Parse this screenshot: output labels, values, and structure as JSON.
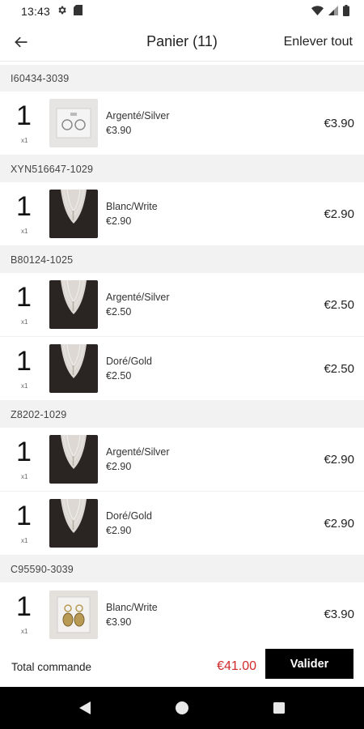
{
  "status_bar": {
    "time": "13:43",
    "icons": [
      "gear-icon",
      "sim-card-icon",
      "wifi-icon",
      "signal-icon",
      "battery-icon"
    ]
  },
  "header": {
    "title": "Panier (11)",
    "clear_all_label": "Enlever tout"
  },
  "groups": [
    {
      "code": "I60434-3039",
      "items": [
        {
          "qty": "1",
          "unit": "x1",
          "variant": "Argenté/Silver",
          "unit_price": "€3.90",
          "price": "€3.90",
          "thumb": "earrings"
        }
      ]
    },
    {
      "code": "XYN516647-1029",
      "items": [
        {
          "qty": "1",
          "unit": "x1",
          "variant": "Blanc/Write",
          "unit_price": "€2.90",
          "price": "€2.90",
          "thumb": "necklace"
        }
      ]
    },
    {
      "code": "B80124-1025",
      "items": [
        {
          "qty": "1",
          "unit": "x1",
          "variant": "Argenté/Silver",
          "unit_price": "€2.50",
          "price": "€2.50",
          "thumb": "necklace"
        },
        {
          "qty": "1",
          "unit": "x1",
          "variant": "Doré/Gold",
          "unit_price": "€2.50",
          "price": "€2.50",
          "thumb": "necklace"
        }
      ]
    },
    {
      "code": "Z8202-1029",
      "items": [
        {
          "qty": "1",
          "unit": "x1",
          "variant": "Argenté/Silver",
          "unit_price": "€2.90",
          "price": "€2.90",
          "thumb": "necklace"
        },
        {
          "qty": "1",
          "unit": "x1",
          "variant": "Doré/Gold",
          "unit_price": "€2.90",
          "price": "€2.90",
          "thumb": "necklace"
        }
      ]
    },
    {
      "code": "C95590-3039",
      "items": [
        {
          "qty": "1",
          "unit": "x1",
          "variant": "Blanc/Write",
          "unit_price": "€3.90",
          "price": "€3.90",
          "thumb": "earrings-gold"
        }
      ]
    }
  ],
  "footer": {
    "total_label": "Total commande",
    "total_value": "€41.00",
    "checkout_label": "Valider"
  },
  "colors": {
    "total": "#d12a2a",
    "checkout_bg": "#000000",
    "group_header_bg": "#f2f2f2"
  },
  "nav_bar": {
    "icons": [
      "back-triangle-icon",
      "home-circle-icon",
      "recents-square-icon"
    ]
  }
}
